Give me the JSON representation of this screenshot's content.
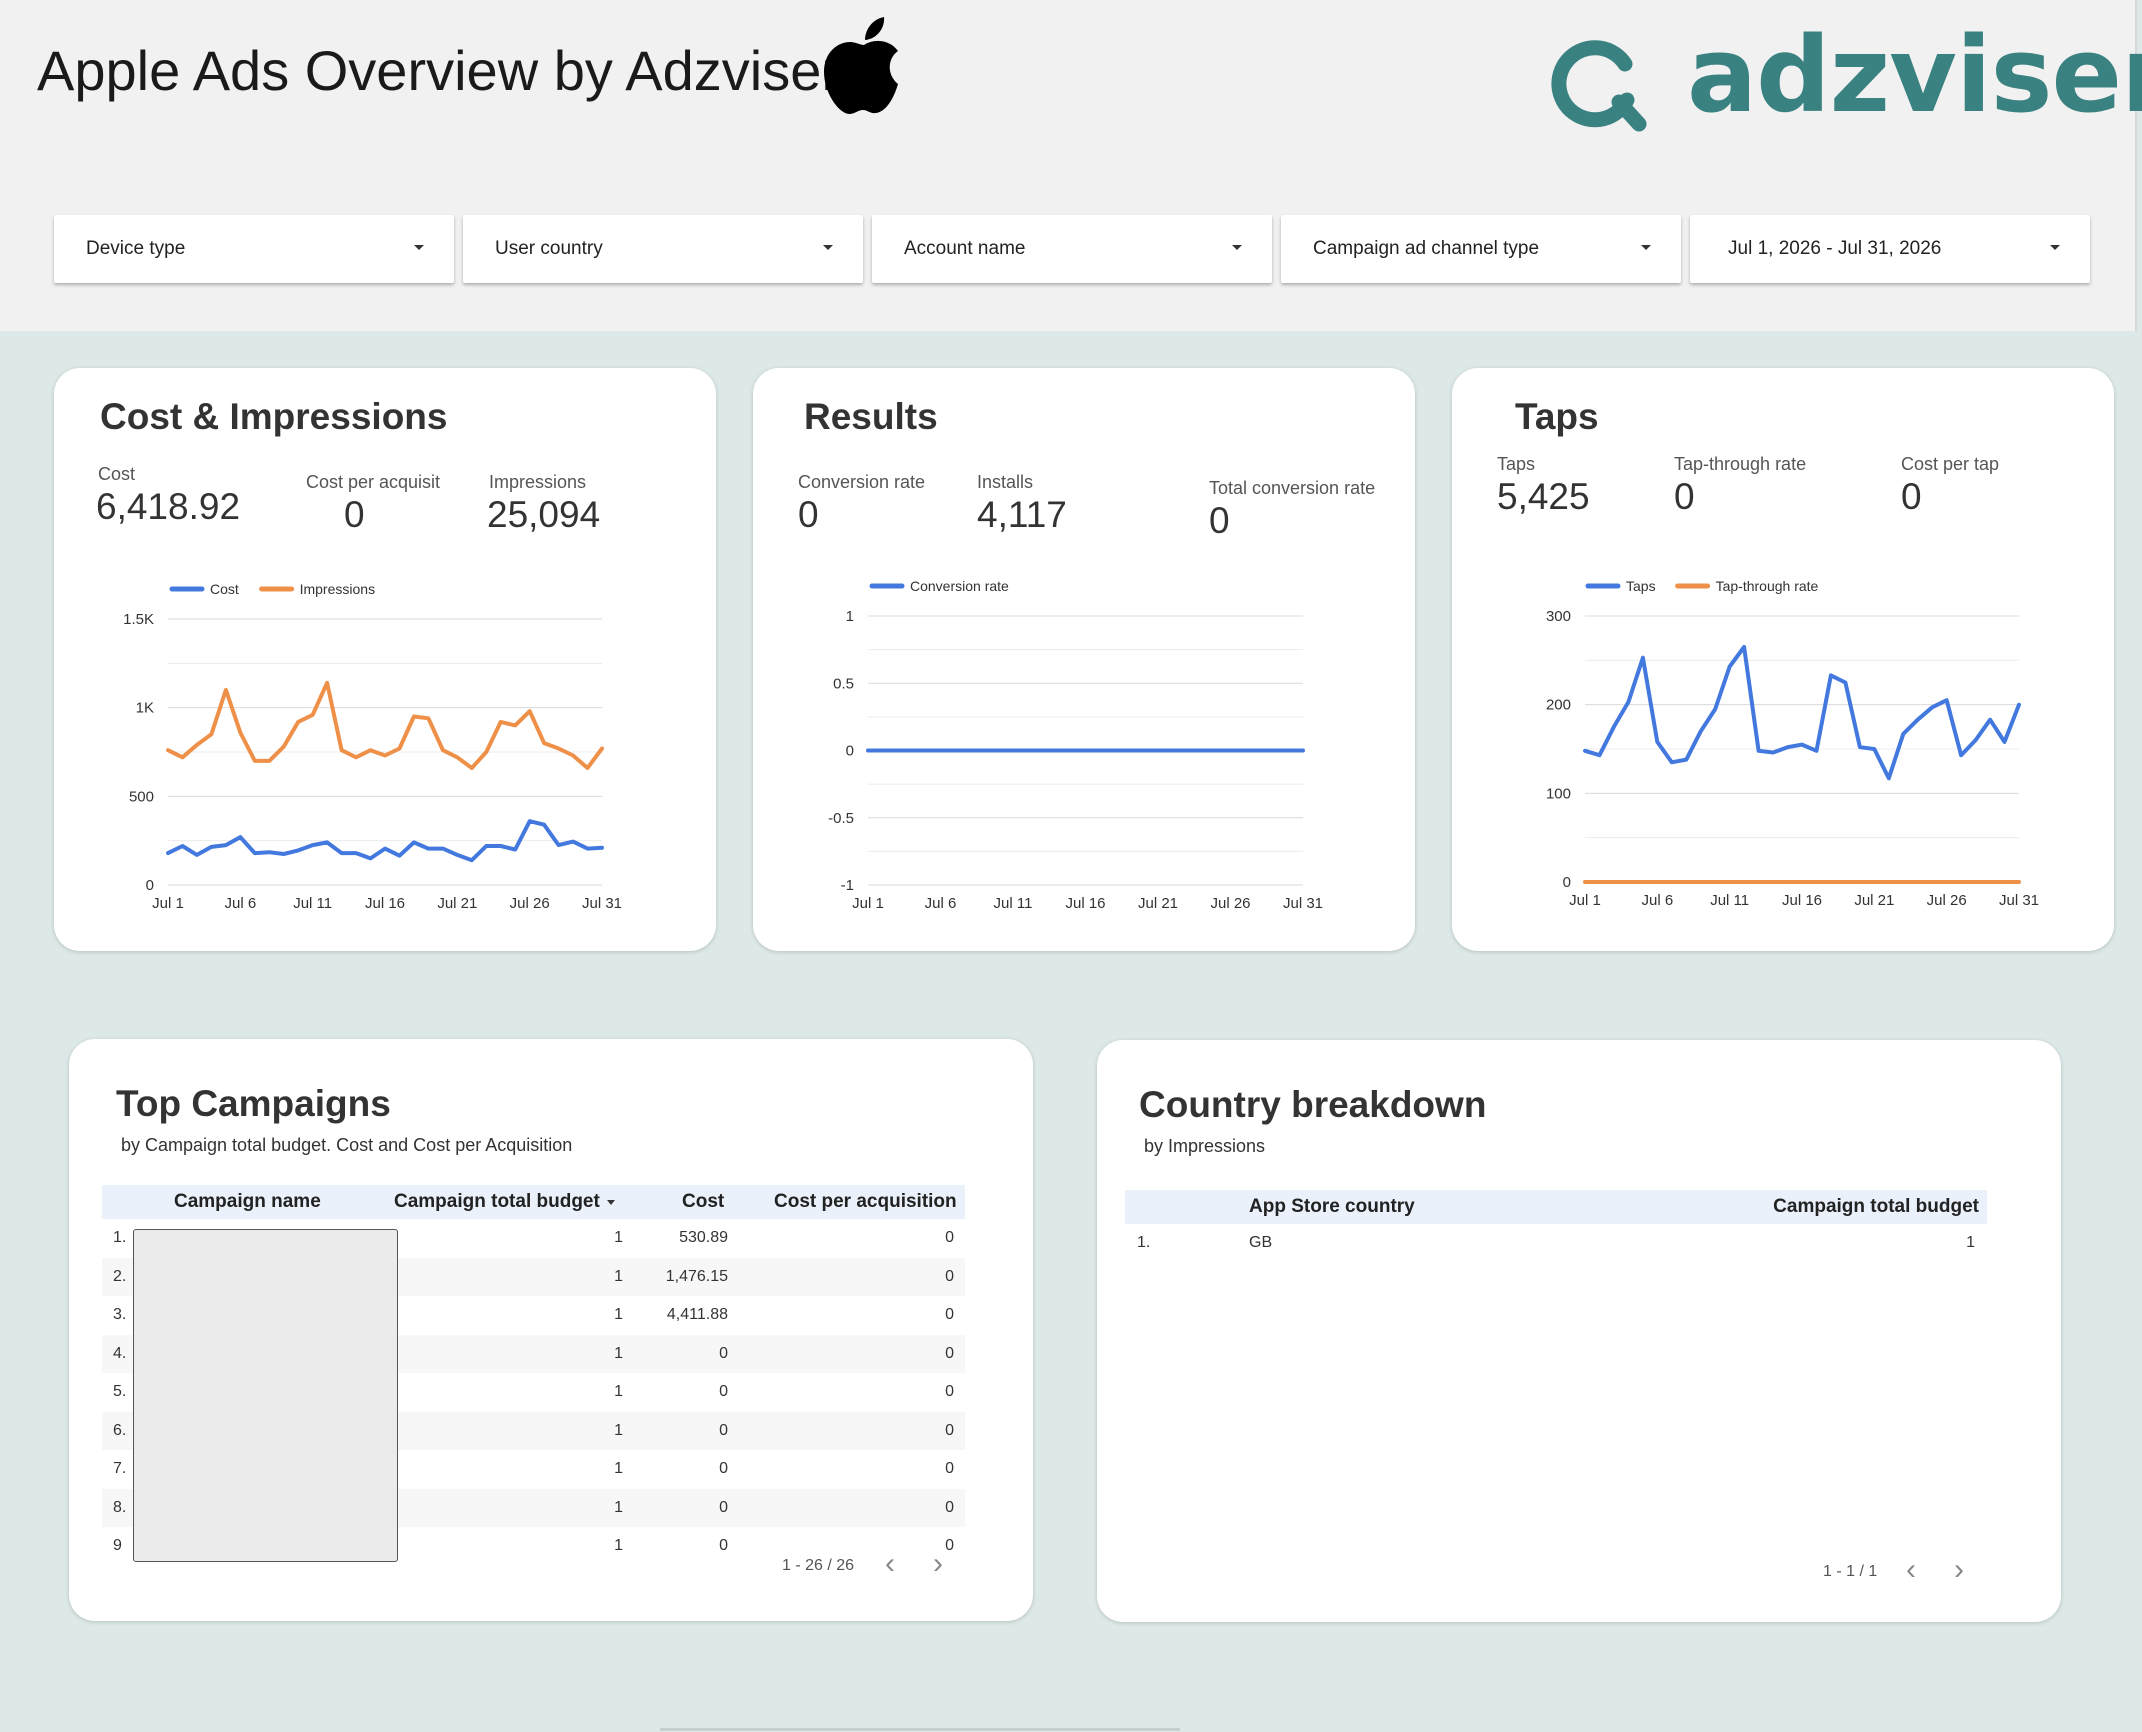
{
  "header": {
    "title": "Apple Ads Overview by Adzviser",
    "brand": "adzviser"
  },
  "filters": [
    {
      "label": "Device type"
    },
    {
      "label": "User country"
    },
    {
      "label": "Account name"
    },
    {
      "label": "Campaign ad channel type"
    },
    {
      "label": "Jul 1, 2026 - Jul 31, 2026"
    }
  ],
  "cost_impressions": {
    "title": "Cost & Impressions",
    "kpis": [
      {
        "label": "Cost",
        "value": "6,418.92"
      },
      {
        "label": "Cost per acquisition",
        "value": "0"
      },
      {
        "label": "Impressions",
        "value": "25,094"
      }
    ]
  },
  "results": {
    "title": "Results",
    "kpis": [
      {
        "label": "Conversion rate",
        "value": "0"
      },
      {
        "label": "Installs",
        "value": "4,117"
      },
      {
        "label": "Total conversion rate",
        "value": "0"
      }
    ]
  },
  "taps": {
    "title": "Taps",
    "kpis": [
      {
        "label": "Taps",
        "value": "5,425"
      },
      {
        "label": "Tap-through rate",
        "value": "0"
      },
      {
        "label": "Cost per tap",
        "value": "0"
      }
    ]
  },
  "chart_data": [
    {
      "type": "line",
      "x": [
        "Jul 1",
        "Jul 2",
        "Jul 3",
        "Jul 4",
        "Jul 5",
        "Jul 6",
        "Jul 7",
        "Jul 8",
        "Jul 9",
        "Jul 10",
        "Jul 11",
        "Jul 12",
        "Jul 13",
        "Jul 14",
        "Jul 15",
        "Jul 16",
        "Jul 17",
        "Jul 18",
        "Jul 19",
        "Jul 20",
        "Jul 21",
        "Jul 22",
        "Jul 23",
        "Jul 24",
        "Jul 25",
        "Jul 26",
        "Jul 27",
        "Jul 28",
        "Jul 29",
        "Jul 30",
        "Jul 31"
      ],
      "xticks": [
        "Jul 1",
        "Jul 6",
        "Jul 11",
        "Jul 16",
        "Jul 21",
        "Jul 26",
        "Jul 31"
      ],
      "yticks": [
        "0",
        "500",
        "1K",
        "1.5K"
      ],
      "ylim": [
        0,
        1500
      ],
      "series": [
        {
          "name": "Cost",
          "color": "#4378df",
          "values": [
            180,
            220,
            170,
            215,
            225,
            270,
            180,
            185,
            175,
            195,
            225,
            240,
            180,
            180,
            150,
            205,
            165,
            240,
            205,
            205,
            170,
            140,
            220,
            220,
            200,
            360,
            340,
            225,
            245,
            205,
            210
          ]
        },
        {
          "name": "Impressions",
          "color": "#ef9048",
          "values": [
            760,
            720,
            790,
            850,
            1100,
            860,
            700,
            700,
            780,
            920,
            960,
            1140,
            760,
            720,
            760,
            730,
            770,
            950,
            940,
            760,
            720,
            660,
            750,
            920,
            900,
            980,
            800,
            770,
            730,
            660,
            770
          ]
        }
      ]
    },
    {
      "type": "line",
      "x": [
        "Jul 1",
        "Jul 2",
        "Jul 3",
        "Jul 4",
        "Jul 5",
        "Jul 6",
        "Jul 7",
        "Jul 8",
        "Jul 9",
        "Jul 10",
        "Jul 11",
        "Jul 12",
        "Jul 13",
        "Jul 14",
        "Jul 15",
        "Jul 16",
        "Jul 17",
        "Jul 18",
        "Jul 19",
        "Jul 20",
        "Jul 21",
        "Jul 22",
        "Jul 23",
        "Jul 24",
        "Jul 25",
        "Jul 26",
        "Jul 27",
        "Jul 28",
        "Jul 29",
        "Jul 30",
        "Jul 31"
      ],
      "xticks": [
        "Jul 1",
        "Jul 6",
        "Jul 11",
        "Jul 16",
        "Jul 21",
        "Jul 26",
        "Jul 31"
      ],
      "yticks": [
        "-1",
        "-0.5",
        "0",
        "0.5",
        "1"
      ],
      "ylim": [
        -1,
        1
      ],
      "series": [
        {
          "name": "Conversion rate",
          "color": "#4378df",
          "values": [
            0,
            0,
            0,
            0,
            0,
            0,
            0,
            0,
            0,
            0,
            0,
            0,
            0,
            0,
            0,
            0,
            0,
            0,
            0,
            0,
            0,
            0,
            0,
            0,
            0,
            0,
            0,
            0,
            0,
            0,
            0
          ]
        }
      ]
    },
    {
      "type": "line",
      "x": [
        "Jul 1",
        "Jul 2",
        "Jul 3",
        "Jul 4",
        "Jul 5",
        "Jul 6",
        "Jul 7",
        "Jul 8",
        "Jul 9",
        "Jul 10",
        "Jul 11",
        "Jul 12",
        "Jul 13",
        "Jul 14",
        "Jul 15",
        "Jul 16",
        "Jul 17",
        "Jul 18",
        "Jul 19",
        "Jul 20",
        "Jul 21",
        "Jul 22",
        "Jul 23",
        "Jul 24",
        "Jul 25",
        "Jul 26",
        "Jul 27",
        "Jul 28",
        "Jul 29",
        "Jul 30",
        "Jul 31"
      ],
      "xticks": [
        "Jul 1",
        "Jul 6",
        "Jul 11",
        "Jul 16",
        "Jul 21",
        "Jul 26",
        "Jul 31"
      ],
      "yticks": [
        "0",
        "100",
        "200",
        "300"
      ],
      "ylim": [
        0,
        300
      ],
      "series": [
        {
          "name": "Taps",
          "color": "#4378df",
          "values": [
            148,
            143,
            175,
            203,
            253,
            158,
            135,
            138,
            170,
            195,
            243,
            265,
            148,
            146,
            152,
            155,
            148,
            233,
            225,
            152,
            150,
            117,
            167,
            183,
            197,
            205,
            143,
            160,
            183,
            158,
            200
          ]
        },
        {
          "name": "Tap-through rate",
          "color": "#ef9048",
          "values": [
            0,
            0,
            0,
            0,
            0,
            0,
            0,
            0,
            0,
            0,
            0,
            0,
            0,
            0,
            0,
            0,
            0,
            0,
            0,
            0,
            0,
            0,
            0,
            0,
            0,
            0,
            0,
            0,
            0,
            0,
            0
          ]
        }
      ]
    },
    {
      "type": "table",
      "title": "Top Campaigns",
      "subtitle": "by Campaign total budget. Cost and Cost per Acquisition",
      "columns": [
        "Campaign name",
        "Campaign total budget",
        "Cost",
        "Cost per acquisition"
      ],
      "rows": [
        {
          "n": "1.",
          "budget": "1",
          "cost": "530.89",
          "cpa": "0"
        },
        {
          "n": "2.",
          "budget": "1",
          "cost": "1,476.15",
          "cpa": "0"
        },
        {
          "n": "3.",
          "budget": "1",
          "cost": "4,411.88",
          "cpa": "0"
        },
        {
          "n": "4.",
          "budget": "1",
          "cost": "0",
          "cpa": "0"
        },
        {
          "n": "5.",
          "budget": "1",
          "cost": "0",
          "cpa": "0"
        },
        {
          "n": "6.",
          "budget": "1",
          "cost": "0",
          "cpa": "0"
        },
        {
          "n": "7.",
          "budget": "1",
          "cost": "0",
          "cpa": "0"
        },
        {
          "n": "8.",
          "budget": "1",
          "cost": "0",
          "cpa": "0"
        },
        {
          "n": "9",
          "budget": "1",
          "cost": "0",
          "cpa": "0"
        }
      ],
      "pagination": "1 - 26 / 26"
    },
    {
      "type": "table",
      "title": "Country breakdown",
      "subtitle": "by Impressions",
      "columns": [
        "App Store country",
        "Campaign total budget"
      ],
      "rows": [
        {
          "n": "1.",
          "country": "GB",
          "budget": "1"
        }
      ],
      "pagination": "1 - 1 / 1"
    }
  ]
}
